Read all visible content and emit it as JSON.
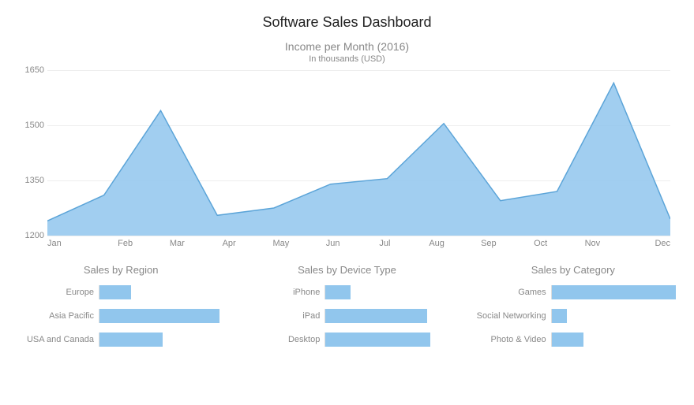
{
  "title": "Software Sales Dashboard",
  "area_chart": {
    "title": "Income per Month (2016)",
    "subtitle": "In thousands (USD)",
    "y_ticks": [
      1200,
      1350,
      1500,
      1650
    ],
    "x_labels": [
      "Jan",
      "Feb",
      "Mar",
      "Apr",
      "May",
      "Jun",
      "Jul",
      "Aug",
      "Sep",
      "Oct",
      "Nov",
      "Dec"
    ]
  },
  "bar_charts": {
    "region": {
      "title": "Sales by Region",
      "rows": [
        {
          "label": "Europe"
        },
        {
          "label": "Asia Pacific"
        },
        {
          "label": "USA and Canada"
        }
      ]
    },
    "device": {
      "title": "Sales by Device Type",
      "rows": [
        {
          "label": "iPhone"
        },
        {
          "label": "iPad"
        },
        {
          "label": "Desktop"
        }
      ]
    },
    "category": {
      "title": "Sales by Category",
      "rows": [
        {
          "label": "Games"
        },
        {
          "label": "Social Networking"
        },
        {
          "label": "Photo & Video"
        }
      ]
    }
  },
  "chart_data": [
    {
      "type": "area",
      "title": "Income per Month (2016)",
      "subtitle": "In thousands (USD)",
      "xlabel": "",
      "ylabel": "",
      "ylim": [
        1200,
        1650
      ],
      "categories": [
        "Jan",
        "Feb",
        "Mar",
        "Apr",
        "May",
        "Jun",
        "Jul",
        "Aug",
        "Sep",
        "Oct",
        "Nov",
        "Dec"
      ],
      "values": [
        1240,
        1310,
        1540,
        1255,
        1275,
        1340,
        1355,
        1505,
        1295,
        1320,
        1615,
        1245
      ]
    },
    {
      "type": "bar",
      "title": "Sales by Region",
      "orientation": "horizontal",
      "categories": [
        "Europe",
        "Asia Pacific",
        "USA and Canada"
      ],
      "values": [
        25,
        95,
        50
      ],
      "xlim": [
        0,
        100
      ]
    },
    {
      "type": "bar",
      "title": "Sales by Device Type",
      "orientation": "horizontal",
      "categories": [
        "iPhone",
        "iPad",
        "Desktop"
      ],
      "values": [
        20,
        80,
        83
      ],
      "xlim": [
        0,
        100
      ]
    },
    {
      "type": "bar",
      "title": "Sales by Category",
      "orientation": "horizontal",
      "categories": [
        "Games",
        "Social Networking",
        "Photo & Video"
      ],
      "values": [
        98,
        12,
        25
      ],
      "xlim": [
        0,
        100
      ]
    }
  ]
}
